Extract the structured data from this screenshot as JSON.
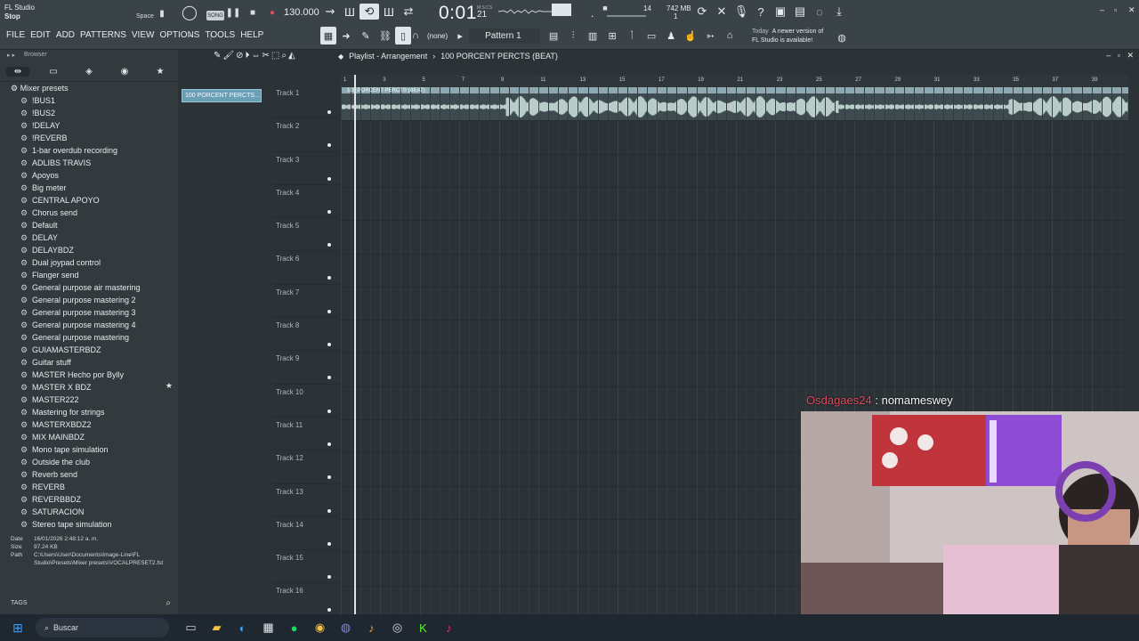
{
  "app": {
    "title": "FL Studio",
    "status": "Stop"
  },
  "menu": [
    "FILE",
    "EDIT",
    "ADD",
    "PATTERNS",
    "VIEW",
    "OPTIONS",
    "TOOLS",
    "HELP"
  ],
  "transport": {
    "space_label": "Space",
    "song_mode": "SONG",
    "tempo": "130.000",
    "time": "0:01",
    "time_sub": "21",
    "time_unit": "M:S:CS",
    "cpu": "14",
    "memory": "742 MB",
    "memory_sub": "1"
  },
  "toolbar2": {
    "snap": "(none)",
    "pattern": "Pattern 1"
  },
  "news": {
    "line1": "Today",
    "line2": "A newer version of",
    "line3": "FL Studio is available!"
  },
  "browser": {
    "header": "Browser",
    "folder": "Mixer presets",
    "items": [
      "!BUS1",
      "!BUS2",
      "!DELAY",
      "!REVERB",
      "1-bar overdub recording",
      "ADLIBS TRAVIS",
      "Apoyos",
      "Big meter",
      "CENTRAL APOYO",
      "Chorus send",
      "Default",
      "DELAY",
      "DELAYBDZ",
      "Dual joypad control",
      "Flanger send",
      "General purpose air mastering",
      "General purpose mastering 2",
      "General purpose mastering 3",
      "General purpose mastering 4",
      "General purpose mastering",
      "GUIAMASTERBDZ",
      "Guitar stuff",
      "MASTER Hecho por Bylly",
      "MASTER X BDZ",
      "MASTER222",
      "Mastering for strings",
      "MASTERXBDZ2",
      "MIX MAINBDZ",
      "Mono tape simulation",
      "Outside the club",
      "Reverb send",
      "REVERB",
      "REVERBBDZ",
      "SATURACION",
      "Stereo tape simulation"
    ],
    "info": {
      "date_label": "Date",
      "date": "16/01/2026 2:48:12 a. m.",
      "size_label": "Size",
      "size": "97.24 KB",
      "path_label": "Path",
      "path": "C:\\Users\\User\\Documents\\Image-Line\\FL Studio\\Presets\\Mixer presets\\VOCALPRESET2.fst"
    },
    "tags": "TAGS"
  },
  "playlist": {
    "title": "Playlist - Arrangement",
    "pattern_name": "100 PORCENT PERCTS (BEAT)",
    "picker_label": "100 PORCENT PERCTS...",
    "clip_label": "100 PORCENT PERCTS (BEAT)",
    "tracks": [
      "Track 1",
      "Track 2",
      "Track 3",
      "Track 4",
      "Track 5",
      "Track 6",
      "Track 7",
      "Track 8",
      "Track 9",
      "Track 10",
      "Track 11",
      "Track 12",
      "Track 13",
      "Track 14",
      "Track 15",
      "Track 16"
    ],
    "bars": [
      "1",
      "3",
      "5",
      "7",
      "9",
      "11",
      "13",
      "15",
      "17",
      "19",
      "21",
      "23",
      "25",
      "27",
      "29",
      "31",
      "33",
      "35",
      "37",
      "39"
    ]
  },
  "chat": {
    "user": "Osdagaes24",
    "message": ": nomameswey"
  },
  "taskbar": {
    "search": "Buscar"
  },
  "colors": {
    "accent": "#6a9fb5",
    "chat_user": "#e04a5f",
    "waveform": "#b8ccc9"
  }
}
